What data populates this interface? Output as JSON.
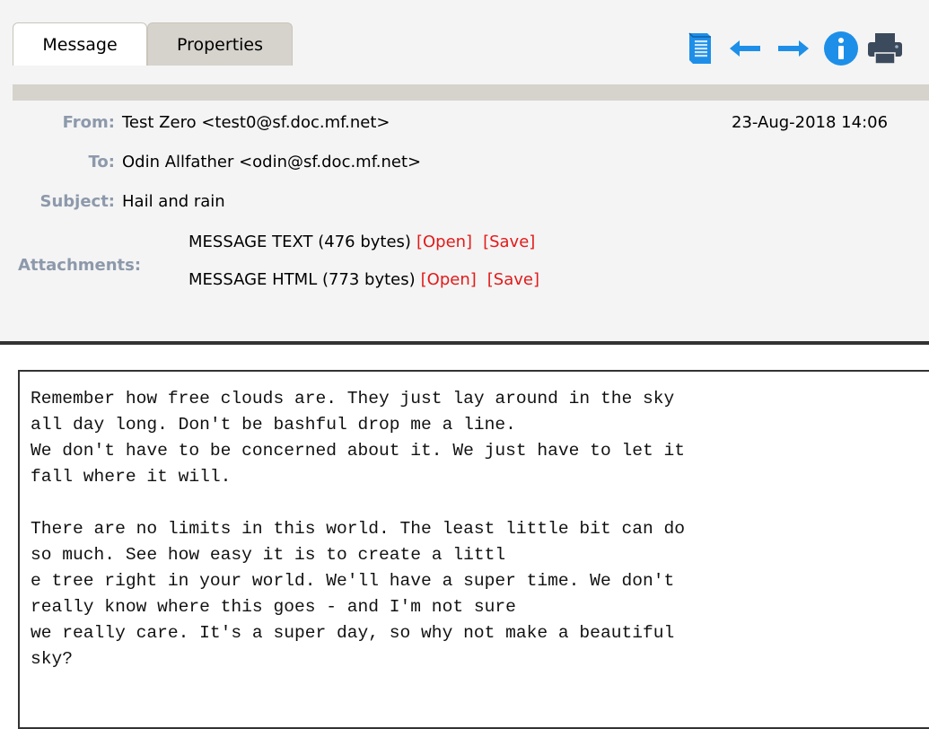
{
  "tabs": [
    {
      "label": "Message",
      "active": true
    },
    {
      "label": "Properties",
      "active": false
    }
  ],
  "toolbar": {
    "icons": [
      "document-icon",
      "arrow-left-icon",
      "arrow-right-icon",
      "info-icon",
      "print-icon"
    ],
    "accent": "#1e8fe8"
  },
  "header": {
    "from_label": "From:",
    "from_value": "Test Zero <test0@sf.doc.mf.net>",
    "date": "23-Aug-2018 14:06",
    "to_label": "To:",
    "to_value": "Odin Allfather <odin@sf.doc.mf.net>",
    "subject_label": "Subject:",
    "subject_value": "Hail and rain",
    "attachments_label": "Attachments:",
    "attachments": [
      {
        "name": "MESSAGE TEXT (476 bytes)",
        "open": "[Open]",
        "save": "[Save]"
      },
      {
        "name": "MESSAGE HTML (773 bytes)",
        "open": "[Open]",
        "save": "[Save]"
      }
    ],
    "label_color": "#8d99ab",
    "link_color": "#e21a1a"
  },
  "body": {
    "text": "Remember how free clouds are. They just lay around in the sky\nall day long. Don't be bashful drop me a line.\nWe don't have to be concerned about it. We just have to let it\nfall where it will.\n\nThere are no limits in this world. The least little bit can do\nso much. See how easy it is to create a littl\ne tree right in your world. We'll have a super time. We don't\nreally know where this goes - and I'm not sure\nwe really care. It's a super day, so why not make a beautiful\nsky?"
  }
}
